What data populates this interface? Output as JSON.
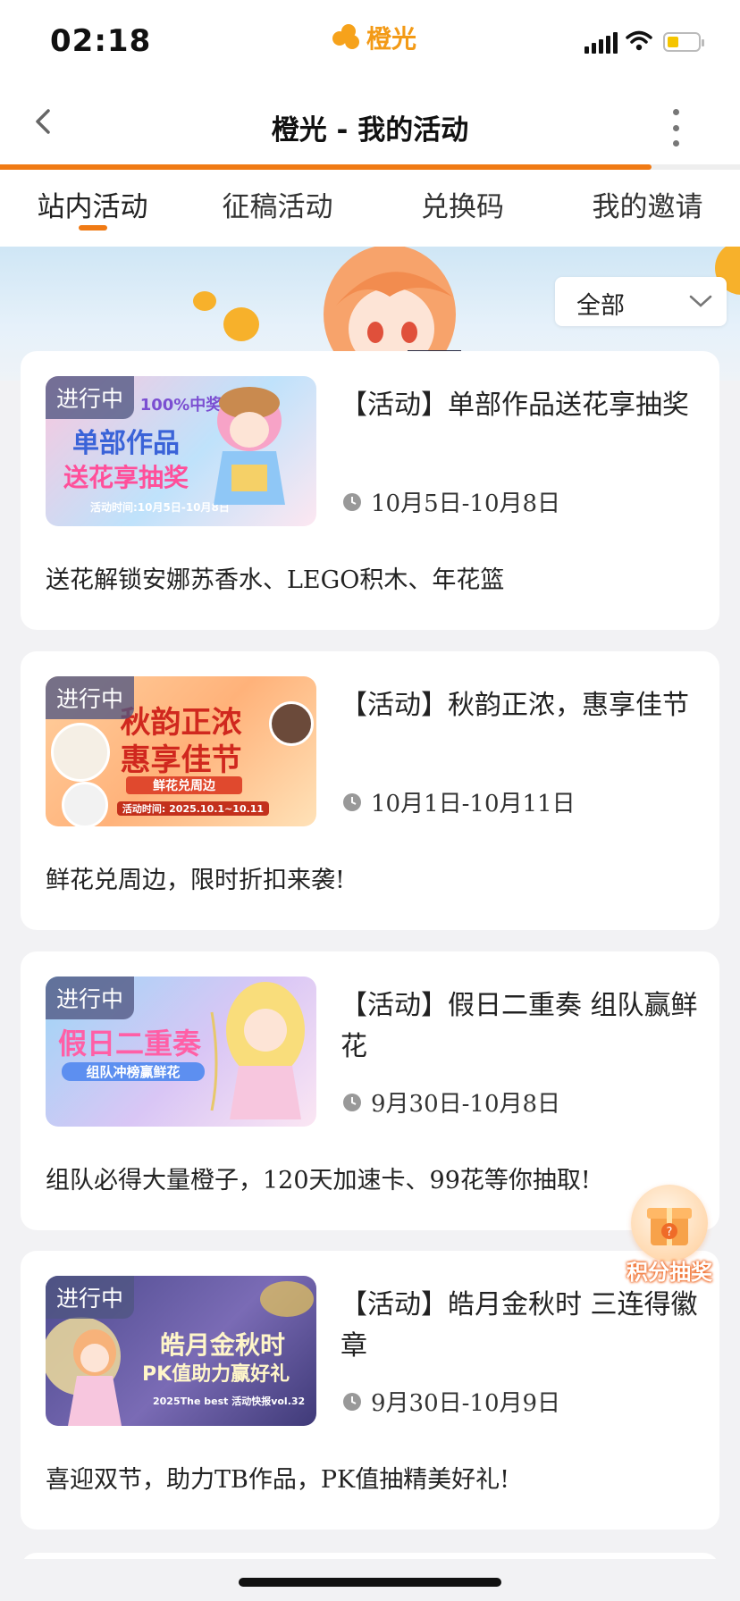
{
  "status_bar": {
    "time": "02:18",
    "app_logo_text": "橙光"
  },
  "header": {
    "title": "橙光 - 我的活动",
    "loading_progress_pct": 88
  },
  "tabs": [
    {
      "label": "站内活动",
      "active": true
    },
    {
      "label": "征稿活动",
      "active": false
    },
    {
      "label": "兑换码",
      "active": false
    },
    {
      "label": "我的邀请",
      "active": false
    }
  ],
  "filter": {
    "selected": "全部"
  },
  "activities": [
    {
      "badge": "进行中",
      "title": "【活动】单部作品送花享抽奖",
      "date": "10月5日-10月8日",
      "desc": "送花解锁安娜苏香水、LEGO积木、年花篮",
      "art": {
        "line1": "单部作品",
        "line2": "送花享抽奖",
        "top": "100%中奖",
        "foot": "活动时间:10月5日-10月8日"
      }
    },
    {
      "badge": "进行中",
      "title": "【活动】秋韵正浓，惠享佳节",
      "date": "10月1日-10月11日",
      "desc": "鲜花兑周边，限时折扣来袭!",
      "art": {
        "line1": "秋韵正浓",
        "line2": "惠享佳节",
        "top": "鲜花兑周边",
        "foot": "活动时间: 2025.10.1~10.11"
      }
    },
    {
      "badge": "进行中",
      "title": "【活动】假日二重奏 组队赢鲜花",
      "date": "9月30日-10月8日",
      "desc": "组队必得大量橙子，120天加速卡、99花等你抽取!",
      "art": {
        "line1": "假日二重奏",
        "line2": "组队冲榜赢鲜花",
        "top": "",
        "foot": ""
      }
    },
    {
      "badge": "进行中",
      "title": "【活动】皓月金秋时 三连得徽章",
      "date": "9月30日-10月9日",
      "desc": "喜迎双节，助力TB作品，PK值抽精美好礼!",
      "art": {
        "line1": "皓月金秋时",
        "line2": "PK值助力赢好礼",
        "top": "",
        "foot": "2025The best 活动快报vol.32"
      }
    }
  ],
  "floating_button": {
    "label": "积分抽奖"
  },
  "colors": {
    "accent": "#f07a14",
    "badge_bg": "#50568280"
  }
}
